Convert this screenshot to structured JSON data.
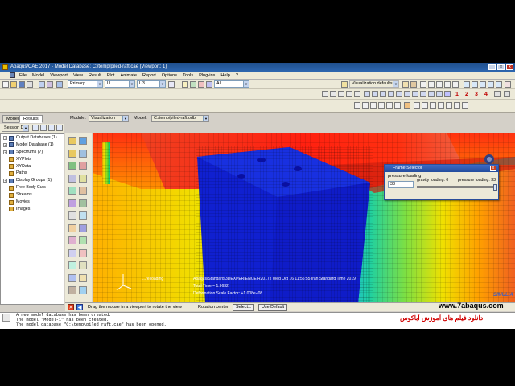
{
  "window": {
    "title": "Abaqus/CAE 2017 - Model Database: C:/temp/piled-raft.cae [Viewport: 1]",
    "controls": [
      "_",
      "□",
      "x"
    ]
  },
  "menu": [
    "File",
    "Model",
    "Viewport",
    "View",
    "Result",
    "Plot",
    "Animate",
    "Report",
    "Options",
    "Tools",
    "Plug-ins",
    "Help",
    "?"
  ],
  "toolbar": {
    "primary_combo": "Primary",
    "primary_var": "U",
    "component": "U3",
    "deformed_filter": "All",
    "visualization_defaults": "Visualization defaults",
    "frame_numbers": [
      "1",
      "2",
      "3",
      "4"
    ]
  },
  "context": {
    "module_label": "Module:",
    "module_value": "Visualization",
    "model_label": "Model:",
    "model_value": "C:/temp/piled-raft.odb"
  },
  "left_tabs": [
    "Model",
    "Results"
  ],
  "session_combo": "Session Da",
  "tree": [
    {
      "label": "Output Databases (1)",
      "expander": "+",
      "sub": false
    },
    {
      "label": "Model Database (1)",
      "expander": "+",
      "sub": false
    },
    {
      "label": "Spectrums (7)",
      "expander": "+",
      "sub": false
    },
    {
      "label": "XYPlots",
      "expander": "",
      "sub": true
    },
    {
      "label": "XYData",
      "expander": "",
      "sub": true
    },
    {
      "label": "Paths",
      "expander": "",
      "sub": true
    },
    {
      "label": "Display Groups (1)",
      "expander": "+",
      "sub": false
    },
    {
      "label": "Free Body Cuts",
      "expander": "",
      "sub": true
    },
    {
      "label": "Streams",
      "expander": "",
      "sub": true
    },
    {
      "label": "Movies",
      "expander": "",
      "sub": true
    },
    {
      "label": "Images",
      "expander": "",
      "sub": true
    }
  ],
  "frame_selector": {
    "title": "Frame Selector",
    "step_label": "pressure loading",
    "frame_value": "33",
    "min_label": "gravity loading: 0",
    "max_label": "pressure loading: 33",
    "slider_fraction": 1.0,
    "close": "x"
  },
  "viewport_info": {
    "line1_partial": "...re loading",
    "line1": "Abaqus/Standard 3DEXPERIENCE R2017x    Wed Oct 16 11:55:55 Iran Standard Time 2019",
    "line2_label": "Total Time =",
    "line2_value": "1.9632",
    "line3_label": "Deformation Scale Factor:",
    "line3_value": "+1.008e+08",
    "brand": "SIMULIA"
  },
  "prompt": {
    "text": "Drag the mouse in a viewport to rotate the view",
    "rotation_center_label": "Rotation center:",
    "select_button": "Select...",
    "use_default_button": "Use Default"
  },
  "messages": [
    "A new model database has been created.",
    "The model \"Model-1\" has been created.",
    "The model database \"C:\\temp\\piled raft.cae\" has been opened."
  ],
  "watermark": {
    "url": "www.7abaqus.com",
    "persian": "دانلود فیلم های آموزش آباکوس"
  },
  "colors": {
    "watermark_url": "#000000",
    "watermark_persian": "#d00000",
    "title_bar": "#2c66b0"
  }
}
